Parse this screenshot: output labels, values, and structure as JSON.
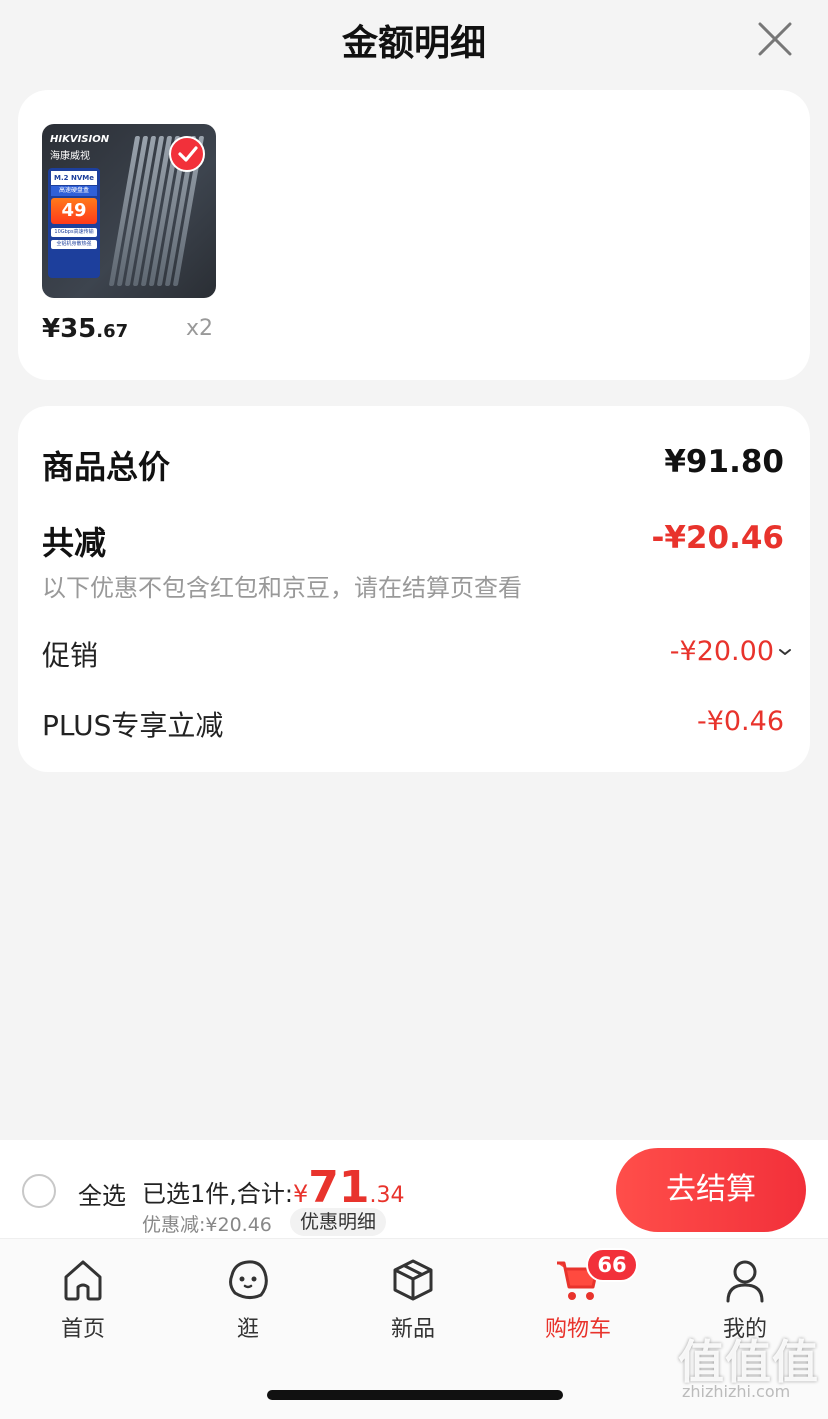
{
  "header": {
    "title": "金额明细"
  },
  "product": {
    "thumbnail": {
      "brand": "HIKVISION",
      "brand_cn": "海康威视",
      "model": "M.2 NVMe",
      "tag": "高速硬盘盒",
      "price_tag": "49",
      "feature1": "10Gbps高速传输",
      "feature2": "全铝机身散热强"
    },
    "unit_price_main": "¥35",
    "unit_price_cents": ".67",
    "quantity": "x2"
  },
  "summary": {
    "total_label": "商品总价",
    "total_value": "¥91.80",
    "reduce_label": "共减",
    "reduce_value": "-¥20.46",
    "note": "以下优惠不包含红包和京豆，请在结算页查看",
    "promo_label": "促销",
    "promo_value": "-¥20.00",
    "plus_label": "PLUS专享立减",
    "plus_value": "-¥0.46"
  },
  "checkout": {
    "select_all": "全选",
    "selected_prefix": "已选1件,合计:",
    "total_yen": "¥",
    "total_big": "71",
    "total_small": ".34",
    "discount_line": "优惠减:¥20.46",
    "detail_chip": "优惠明细",
    "button": "去结算"
  },
  "tabbar": {
    "tabs": [
      {
        "label": "首页",
        "icon": "home-icon"
      },
      {
        "label": "逛",
        "icon": "face-icon"
      },
      {
        "label": "新品",
        "icon": "box-icon"
      },
      {
        "label": "购物车",
        "icon": "cart-icon"
      },
      {
        "label": "我的",
        "icon": "person-icon"
      }
    ],
    "cart_badge": "66"
  },
  "watermark": {
    "glyphs": "值值值",
    "domain": "zhizhizhi.com"
  },
  "colors": {
    "accent_red": "#e8332c",
    "button_red": "#f2303a",
    "background": "#f4f4f4"
  }
}
